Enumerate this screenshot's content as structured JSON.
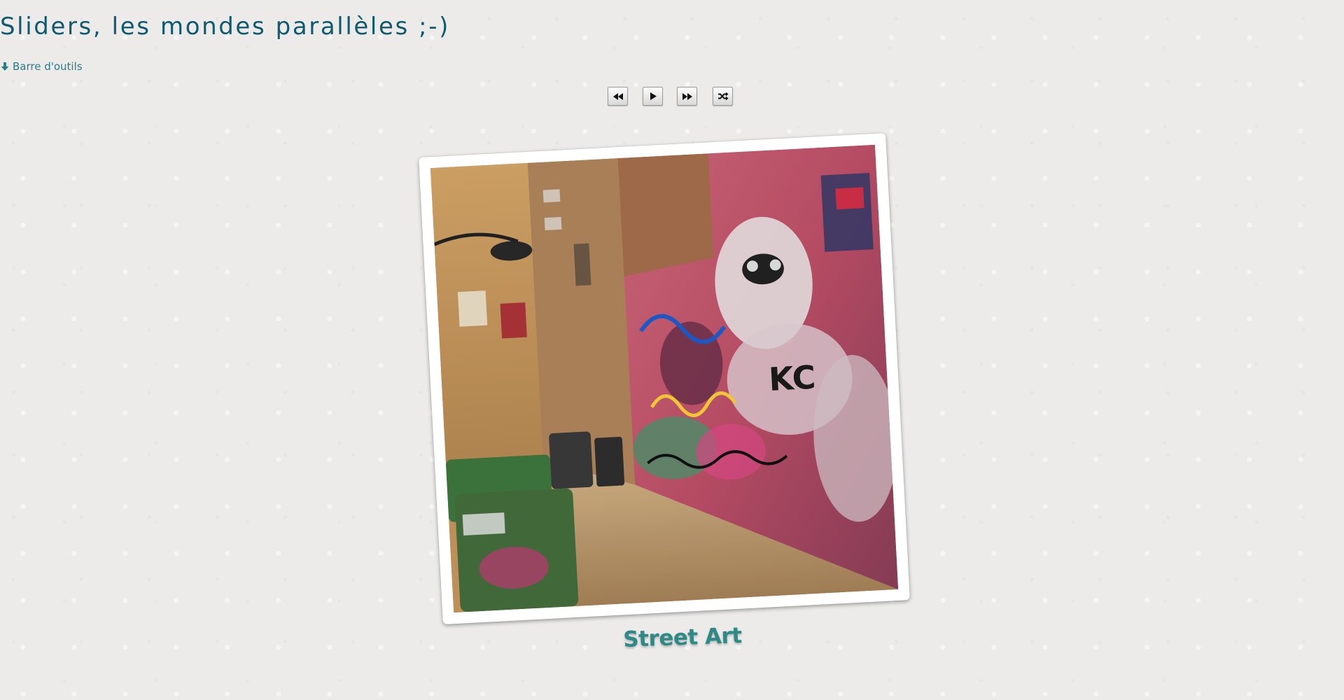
{
  "page": {
    "title": "Sliders, les mondes parallèles ;-)"
  },
  "toolbar_toggle": {
    "label": "Barre d'outils",
    "icon": "arrow-down-icon"
  },
  "controls": {
    "buttons": [
      {
        "name": "previous",
        "icon": "rewind-icon"
      },
      {
        "name": "play",
        "icon": "play-icon"
      },
      {
        "name": "next",
        "icon": "fast-forward-icon"
      },
      {
        "name": "shuffle",
        "icon": "shuffle-icon"
      }
    ]
  },
  "slide": {
    "caption": "Street Art",
    "image_subject": "graffiti-covered city laneway with wheelie bins"
  },
  "colors": {
    "background": "#ecebea",
    "title": "#0f5a6e",
    "link": "#2b7d86",
    "caption": "#2d8a86"
  }
}
